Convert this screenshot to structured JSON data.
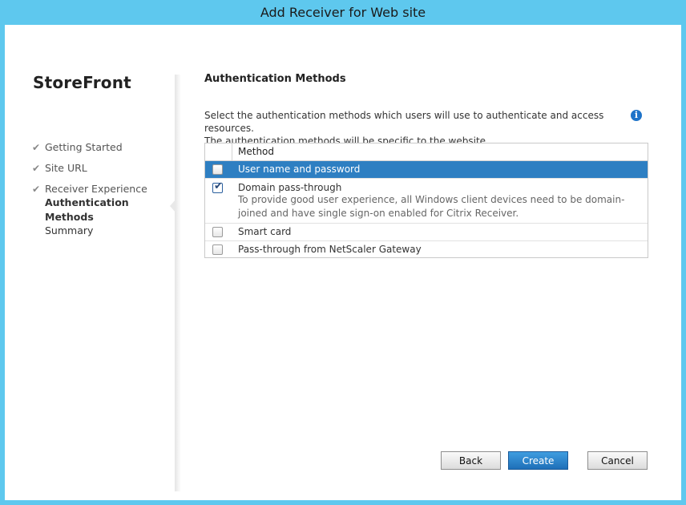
{
  "window": {
    "title": "Add Receiver for Web site"
  },
  "sidebar": {
    "brand": "StoreFront",
    "steps": [
      {
        "label": "Getting Started",
        "state": "done"
      },
      {
        "label": "Site URL",
        "state": "done"
      },
      {
        "label": "Receiver Experience",
        "state": "done"
      },
      {
        "label": "Authentication Methods",
        "state": "current"
      },
      {
        "label": "Summary",
        "state": "pending"
      }
    ]
  },
  "main": {
    "title": "Authentication Methods",
    "description_line1": "Select the authentication methods which users will use to authenticate and access resources.",
    "description_line2": "The authentication methods will be specific to the website.",
    "info_icon": "i",
    "table": {
      "header": "Method",
      "rows": [
        {
          "label": "User name and password",
          "checked": false,
          "selected": true
        },
        {
          "label": "Domain pass-through",
          "checked": true,
          "selected": false,
          "sub_line1": "To provide good user experience, all Windows client devices need to be domain-",
          "sub_line2": "joined and have single sign-on enabled for Citrix Receiver."
        },
        {
          "label": "Smart card",
          "checked": false,
          "selected": false
        },
        {
          "label": "Pass-through from NetScaler Gateway",
          "checked": false,
          "selected": false
        }
      ]
    }
  },
  "footer": {
    "back": "Back",
    "create": "Create",
    "cancel": "Cancel"
  },
  "colors": {
    "frame": "#5ec8ee",
    "selection": "#2e7fc2",
    "primary_button": "#1e6fb8"
  }
}
